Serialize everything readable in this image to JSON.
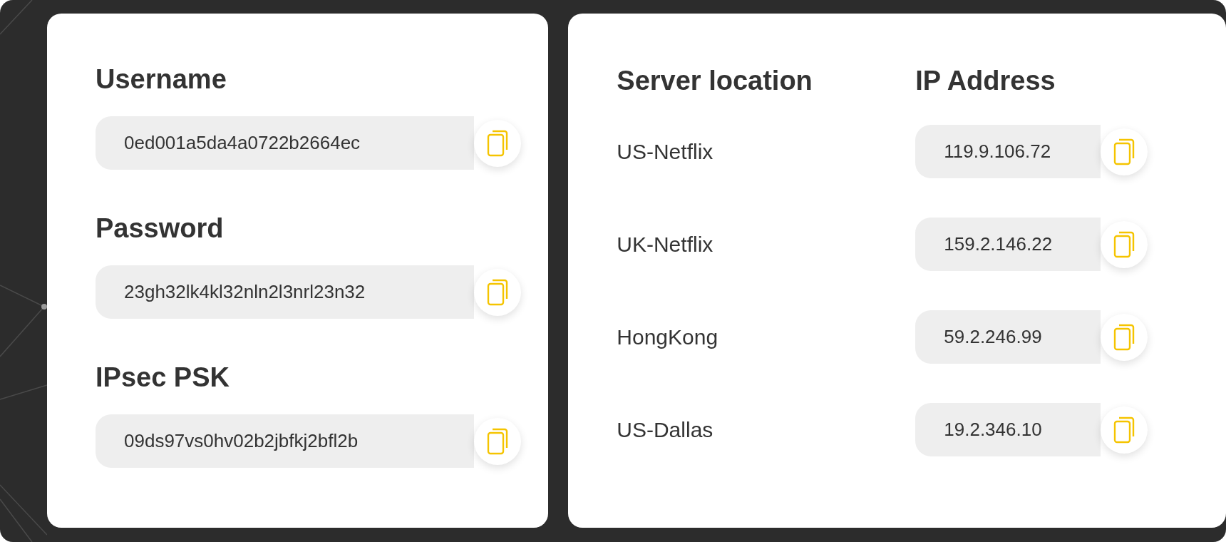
{
  "credentials": [
    {
      "label": "Username",
      "value": "0ed001a5da4a0722b2664ec"
    },
    {
      "label": "Password",
      "value": "23gh32lk4kl32nln2l3nrl23n32"
    },
    {
      "label": "IPsec PSK",
      "value": "09ds97vs0hv02b2jbfkj2bfl2b"
    }
  ],
  "servers": {
    "columns": [
      "Server location",
      "IP Address"
    ],
    "rows": [
      {
        "location": "US-Netflix",
        "ip": "119.9.106.72"
      },
      {
        "location": "UK-Netflix",
        "ip": "159.2.146.22"
      },
      {
        "location": "HongKong",
        "ip": "59.2.246.99"
      },
      {
        "location": "US-Dallas",
        "ip": "19.2.346.10"
      }
    ]
  }
}
